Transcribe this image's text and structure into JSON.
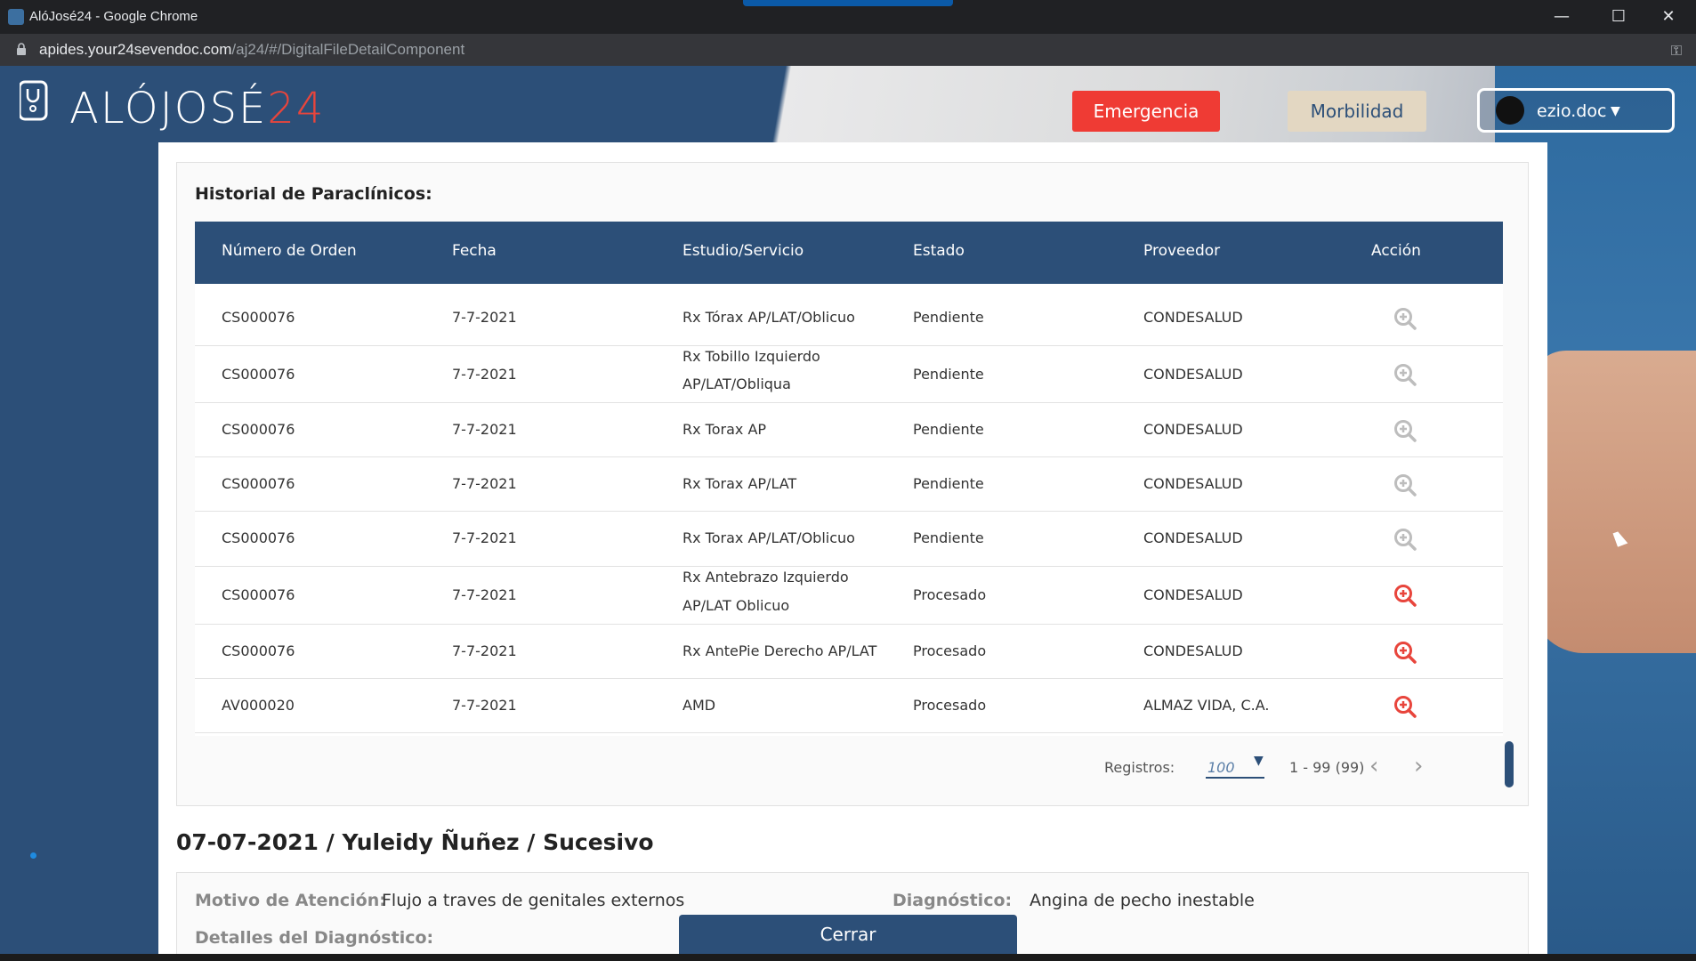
{
  "browser": {
    "window_title": "AlóJosé24 - Google Chrome",
    "url_host": "apides.your24sevendoc.com",
    "url_path": "/aj24/#/DigitalFileDetailComponent",
    "minimize_glyph": "—",
    "maximize_glyph": "☐",
    "close_glyph": "✕",
    "key_glyph": "⚿"
  },
  "header": {
    "logo_text_white": "ALÓJOSÉ",
    "logo_text_red": "24",
    "emergency_label": "Emergencia",
    "morbilidad_label": "Morbilidad",
    "username": "ezio.doc",
    "caret": "▼"
  },
  "colors": {
    "primary": "#2c4f78",
    "emergency": "#ef3b34",
    "morbilidad": "#e3d7c2",
    "zoom_active": "#e8453c",
    "zoom_inactive": "#bdbdbd"
  },
  "paraclinicos": {
    "title": "Historial de Paraclínicos:",
    "columns": [
      "Número de Orden",
      "Fecha",
      "Estudio/Servicio",
      "Estado",
      "Proveedor",
      "Acción"
    ],
    "rows": [
      {
        "orden": "CS000076",
        "fecha": "7-7-2021",
        "estudio": "Rx Tórax AP/LAT/Oblicuo",
        "estado": "Pendiente",
        "proveedor": "CONDESALUD",
        "accion": "zoom-in-icon-disabled"
      },
      {
        "orden": "CS000076",
        "fecha": "7-7-2021",
        "estudio": "Rx Tobillo Izquierdo AP/LAT/Obliqua",
        "estado": "Pendiente",
        "proveedor": "CONDESALUD",
        "accion": "zoom-in-icon-disabled"
      },
      {
        "orden": "CS000076",
        "fecha": "7-7-2021",
        "estudio": "Rx Torax AP",
        "estado": "Pendiente",
        "proveedor": "CONDESALUD",
        "accion": "zoom-in-icon-disabled"
      },
      {
        "orden": "CS000076",
        "fecha": "7-7-2021",
        "estudio": "Rx Torax AP/LAT",
        "estado": "Pendiente",
        "proveedor": "CONDESALUD",
        "accion": "zoom-in-icon-disabled"
      },
      {
        "orden": "CS000076",
        "fecha": "7-7-2021",
        "estudio": "Rx Torax AP/LAT/Oblicuo",
        "estado": "Pendiente",
        "proveedor": "CONDESALUD",
        "accion": "zoom-in-icon-disabled"
      },
      {
        "orden": "CS000076",
        "fecha": "7-7-2021",
        "estudio": "Rx Antebrazo Izquierdo AP/LAT Oblicuo",
        "estado": "Procesado",
        "proveedor": "CONDESALUD",
        "accion": "zoom-in-icon"
      },
      {
        "orden": "CS000076",
        "fecha": "7-7-2021",
        "estudio": "Rx AntePie Derecho AP/LAT",
        "estado": "Procesado",
        "proveedor": "CONDESALUD",
        "accion": "zoom-in-icon"
      },
      {
        "orden": "AV000020",
        "fecha": "7-7-2021",
        "estudio": "AMD",
        "estado": "Procesado",
        "proveedor": "ALMAZ VIDA, C.A.",
        "accion": "zoom-in-icon"
      }
    ],
    "rows_split": [
      [
        "Rx Tobillo Izquierdo",
        "AP/LAT/Obliqua"
      ],
      [
        "Rx Antebrazo Izquierdo",
        "AP/LAT Oblicuo"
      ]
    ],
    "pagination": {
      "registros_label": "Registros:",
      "page_size": "100",
      "range": "1 - 99 (99)",
      "prev": "‹",
      "next": "›"
    }
  },
  "consulta": {
    "title": "07-07-2021 / Yuleidy Ñuñez / Sucesivo",
    "motivo_label": "Motivo de Atención:",
    "motivo_value": "Flujo a traves de genitales externos",
    "diagnostico_label": "Diagnóstico:",
    "diagnostico_value": "Angina de pecho inestable",
    "detalles_label": "Detalles del Diagnóstico:"
  },
  "footer": {
    "close_label": "Cerrar"
  }
}
